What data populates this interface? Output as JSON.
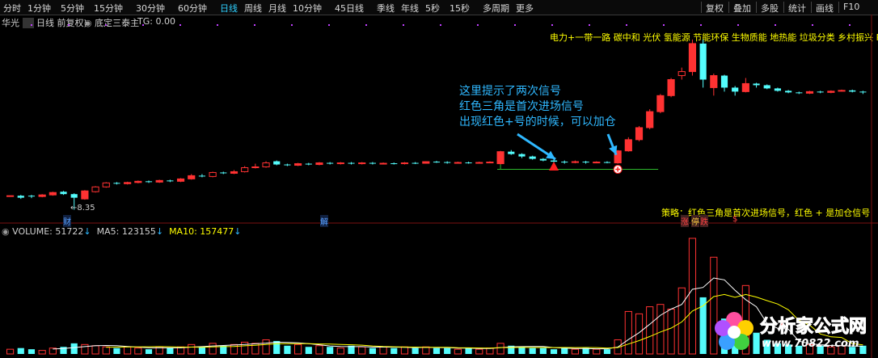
{
  "toolbar": {
    "periods": [
      "分时",
      "1分钟",
      "5分钟",
      "15分钟",
      "30分钟",
      "60分钟",
      "日线",
      "周线",
      "月线",
      "10分钟",
      "45日线",
      "季线",
      "年线",
      "5秒",
      "15秒",
      "多周期",
      "更多"
    ],
    "active": "日线",
    "right_tools": [
      "复权",
      "叠加",
      "多股",
      "统计",
      "画线",
      "F10"
    ]
  },
  "price_header": {
    "stock": "华光",
    "mode": "日线 前复权",
    "indicator": "底定三泰主",
    "tg": "TG: 0.00"
  },
  "concept_banner": "电力+一带一路 碳中和 光伏 氢能源 节能环保 生物质能 地热能 垃圾分类 乡村振兴 PPP概念 E",
  "annotation": {
    "lines": [
      "这里提示了两次信号",
      "红色三角是首次进场信号",
      "出现红色+号的时候，可以加仓"
    ]
  },
  "strategy_note": "策略：红色三角是首次进场信号，红色 + 是加仓信号",
  "low_marker": "8.35",
  "axis_markers": {
    "cai": "财",
    "jie": "解",
    "zhang": "涨",
    "ting": "停",
    "die": "跌",
    "dollar": "$"
  },
  "volume_header": {
    "volume_label": "VOLUME:",
    "volume_value": "51722",
    "ma5_label": "MA5:",
    "ma5_value": "123155",
    "ma10_label": "MA10:",
    "ma10_value": "157477",
    "arrow": "↓"
  },
  "logo": {
    "name": "分析家公式网",
    "url": "www.70822.com"
  },
  "colors": {
    "up": "#ff3232",
    "down": "#54fcfc",
    "ma5": "#ffffff",
    "ma10": "#ffff00",
    "annotation": "#2fb8ff",
    "concept": "#ffff00",
    "signal_line": "#2db82d"
  },
  "candles": [
    {
      "o": 8.7,
      "c": 8.7,
      "h": 8.7,
      "l": 8.7,
      "v": 4
    },
    {
      "o": 8.7,
      "c": 8.65,
      "h": 8.72,
      "l": 8.62,
      "v": 5
    },
    {
      "o": 8.7,
      "c": 8.68,
      "h": 8.72,
      "l": 8.64,
      "v": 4
    },
    {
      "o": 8.68,
      "c": 8.72,
      "h": 8.74,
      "l": 8.66,
      "v": 3
    },
    {
      "o": 8.72,
      "c": 8.78,
      "h": 8.8,
      "l": 8.7,
      "v": 5
    },
    {
      "o": 8.8,
      "c": 8.74,
      "h": 8.82,
      "l": 8.72,
      "v": 6
    },
    {
      "o": 8.74,
      "c": 8.65,
      "h": 8.76,
      "l": 8.35,
      "v": 9
    },
    {
      "o": 8.62,
      "c": 8.82,
      "h": 8.84,
      "l": 8.6,
      "v": 8
    },
    {
      "o": 8.8,
      "c": 8.92,
      "h": 8.94,
      "l": 8.78,
      "v": 7
    },
    {
      "o": 8.92,
      "c": 9.02,
      "h": 9.04,
      "l": 8.9,
      "v": 6
    },
    {
      "o": 9.02,
      "c": 9.0,
      "h": 9.04,
      "l": 8.98,
      "v": 5
    },
    {
      "o": 9.0,
      "c": 9.03,
      "h": 9.05,
      "l": 8.98,
      "v": 6
    },
    {
      "o": 9.03,
      "c": 9.06,
      "h": 9.08,
      "l": 9.01,
      "v": 5
    },
    {
      "o": 9.06,
      "c": 9.04,
      "h": 9.08,
      "l": 9.02,
      "v": 4
    },
    {
      "o": 9.04,
      "c": 9.08,
      "h": 9.1,
      "l": 9.02,
      "v": 6
    },
    {
      "o": 9.08,
      "c": 9.06,
      "h": 9.1,
      "l": 9.04,
      "v": 5
    },
    {
      "o": 9.06,
      "c": 9.12,
      "h": 9.14,
      "l": 9.04,
      "v": 6
    },
    {
      "o": 9.12,
      "c": 9.2,
      "h": 9.24,
      "l": 9.1,
      "v": 8
    },
    {
      "o": 9.2,
      "c": 9.18,
      "h": 9.24,
      "l": 9.16,
      "v": 6
    },
    {
      "o": 9.18,
      "c": 9.28,
      "h": 9.3,
      "l": 9.16,
      "v": 9
    },
    {
      "o": 9.28,
      "c": 9.26,
      "h": 9.3,
      "l": 9.24,
      "v": 7
    },
    {
      "o": 9.26,
      "c": 9.3,
      "h": 9.34,
      "l": 9.24,
      "v": 8
    },
    {
      "o": 9.3,
      "c": 9.4,
      "h": 9.44,
      "l": 9.28,
      "v": 10
    },
    {
      "o": 9.4,
      "c": 9.42,
      "h": 9.5,
      "l": 9.38,
      "v": 9
    },
    {
      "o": 9.42,
      "c": 9.52,
      "h": 9.56,
      "l": 9.4,
      "v": 12
    },
    {
      "o": 9.56,
      "c": 9.48,
      "h": 9.58,
      "l": 9.46,
      "v": 11
    },
    {
      "o": 9.48,
      "c": 9.46,
      "h": 9.5,
      "l": 9.44,
      "v": 7
    },
    {
      "o": 9.46,
      "c": 9.5,
      "h": 9.52,
      "l": 9.44,
      "v": 8
    },
    {
      "o": 9.5,
      "c": 9.48,
      "h": 9.52,
      "l": 9.46,
      "v": 6
    },
    {
      "o": 9.48,
      "c": 9.52,
      "h": 9.54,
      "l": 9.46,
      "v": 7
    },
    {
      "o": 9.52,
      "c": 9.5,
      "h": 9.54,
      "l": 9.48,
      "v": 6
    },
    {
      "o": 9.5,
      "c": 9.52,
      "h": 9.54,
      "l": 9.48,
      "v": 5
    },
    {
      "o": 9.52,
      "c": 9.5,
      "h": 9.54,
      "l": 9.48,
      "v": 7
    },
    {
      "o": 9.5,
      "c": 9.52,
      "h": 9.54,
      "l": 9.48,
      "v": 6
    },
    {
      "o": 9.52,
      "c": 9.5,
      "h": 9.54,
      "l": 9.48,
      "v": 5
    },
    {
      "o": 9.5,
      "c": 9.51,
      "h": 9.53,
      "l": 9.48,
      "v": 6
    },
    {
      "o": 9.51,
      "c": 9.5,
      "h": 9.53,
      "l": 9.48,
      "v": 5
    },
    {
      "o": 9.5,
      "c": 9.52,
      "h": 9.54,
      "l": 9.48,
      "v": 6
    },
    {
      "o": 9.52,
      "c": 9.51,
      "h": 9.54,
      "l": 9.49,
      "v": 5
    },
    {
      "o": 9.51,
      "c": 9.55,
      "h": 9.56,
      "l": 9.5,
      "v": 6
    },
    {
      "o": 9.55,
      "c": 9.54,
      "h": 9.57,
      "l": 9.52,
      "v": 5
    },
    {
      "o": 9.54,
      "c": 9.52,
      "h": 9.56,
      "l": 9.5,
      "v": 5
    },
    {
      "o": 9.52,
      "c": 9.53,
      "h": 9.55,
      "l": 9.51,
      "v": 4
    },
    {
      "o": 9.53,
      "c": 9.52,
      "h": 9.55,
      "l": 9.5,
      "v": 5
    },
    {
      "o": 9.52,
      "c": 9.53,
      "h": 9.55,
      "l": 9.51,
      "v": 4
    },
    {
      "o": 9.53,
      "c": 9.54,
      "h": 9.56,
      "l": 9.52,
      "v": 5
    },
    {
      "o": 9.5,
      "c": 9.8,
      "h": 9.82,
      "l": 9.48,
      "v": 9
    },
    {
      "o": 9.8,
      "c": 9.74,
      "h": 9.84,
      "l": 9.72,
      "v": 7
    },
    {
      "o": 9.74,
      "c": 9.68,
      "h": 9.76,
      "l": 9.64,
      "v": 6
    },
    {
      "o": 9.68,
      "c": 9.62,
      "h": 9.7,
      "l": 9.6,
      "v": 5
    },
    {
      "o": 9.62,
      "c": 9.58,
      "h": 9.64,
      "l": 9.56,
      "v": 5
    },
    {
      "o": 9.58,
      "c": 9.55,
      "h": 9.61,
      "l": 9.53,
      "v": 4
    },
    {
      "o": 9.55,
      "c": 9.53,
      "h": 9.58,
      "l": 9.5,
      "v": 5
    },
    {
      "o": 9.53,
      "c": 9.55,
      "h": 9.58,
      "l": 9.51,
      "v": 4
    },
    {
      "o": 9.55,
      "c": 9.53,
      "h": 9.57,
      "l": 9.5,
      "v": 5
    },
    {
      "o": 9.53,
      "c": 9.54,
      "h": 9.56,
      "l": 9.51,
      "v": 4
    },
    {
      "o": 9.54,
      "c": 9.53,
      "h": 9.56,
      "l": 9.51,
      "v": 4
    },
    {
      "o": 9.52,
      "c": 9.82,
      "h": 9.84,
      "l": 9.5,
      "v": 12
    },
    {
      "o": 9.82,
      "c": 10.1,
      "h": 10.16,
      "l": 9.8,
      "v": 36
    },
    {
      "o": 10.1,
      "c": 10.4,
      "h": 10.44,
      "l": 10.06,
      "v": 34
    },
    {
      "o": 10.4,
      "c": 10.8,
      "h": 10.86,
      "l": 10.36,
      "v": 40
    },
    {
      "o": 10.8,
      "c": 11.2,
      "h": 11.24,
      "l": 10.76,
      "v": 42
    },
    {
      "o": 11.2,
      "c": 11.6,
      "h": 11.64,
      "l": 11.16,
      "v": 38
    },
    {
      "o": 11.7,
      "c": 11.8,
      "h": 11.9,
      "l": 11.6,
      "v": 56
    },
    {
      "o": 11.8,
      "c": 12.5,
      "h": 12.6,
      "l": 11.7,
      "v": 98
    },
    {
      "o": 12.5,
      "c": 11.6,
      "h": 12.6,
      "l": 11.4,
      "v": 48
    },
    {
      "o": 11.4,
      "c": 11.7,
      "h": 11.75,
      "l": 11.2,
      "v": 82
    },
    {
      "o": 11.7,
      "c": 11.4,
      "h": 11.72,
      "l": 11.3,
      "v": 30
    },
    {
      "o": 11.4,
      "c": 11.3,
      "h": 11.44,
      "l": 11.2,
      "v": 12
    },
    {
      "o": 11.3,
      "c": 11.5,
      "h": 11.64,
      "l": 11.28,
      "v": 58
    },
    {
      "o": 11.5,
      "c": 11.46,
      "h": 11.52,
      "l": 11.4,
      "v": 18
    },
    {
      "o": 11.46,
      "c": 11.38,
      "h": 11.48,
      "l": 11.36,
      "v": 12
    },
    {
      "o": 11.38,
      "c": 11.32,
      "h": 11.4,
      "l": 11.3,
      "v": 9
    },
    {
      "o": 11.32,
      "c": 11.28,
      "h": 11.34,
      "l": 11.26,
      "v": 8
    },
    {
      "o": 11.28,
      "c": 11.26,
      "h": 11.3,
      "l": 11.24,
      "v": 7
    },
    {
      "o": 11.26,
      "c": 11.3,
      "h": 11.32,
      "l": 11.24,
      "v": 8
    },
    {
      "o": 11.3,
      "c": 11.28,
      "h": 11.32,
      "l": 11.26,
      "v": 7
    },
    {
      "o": 11.28,
      "c": 11.31,
      "h": 11.33,
      "l": 11.26,
      "v": 6
    },
    {
      "o": 11.31,
      "c": 11.33,
      "h": 11.35,
      "l": 11.3,
      "v": 7
    },
    {
      "o": 11.33,
      "c": 11.3,
      "h": 11.35,
      "l": 11.28,
      "v": 6
    },
    {
      "o": 11.3,
      "c": 11.28,
      "h": 11.32,
      "l": 11.24,
      "v": 7
    }
  ],
  "signals": {
    "triangle_index": 51,
    "plus_index": 57
  }
}
